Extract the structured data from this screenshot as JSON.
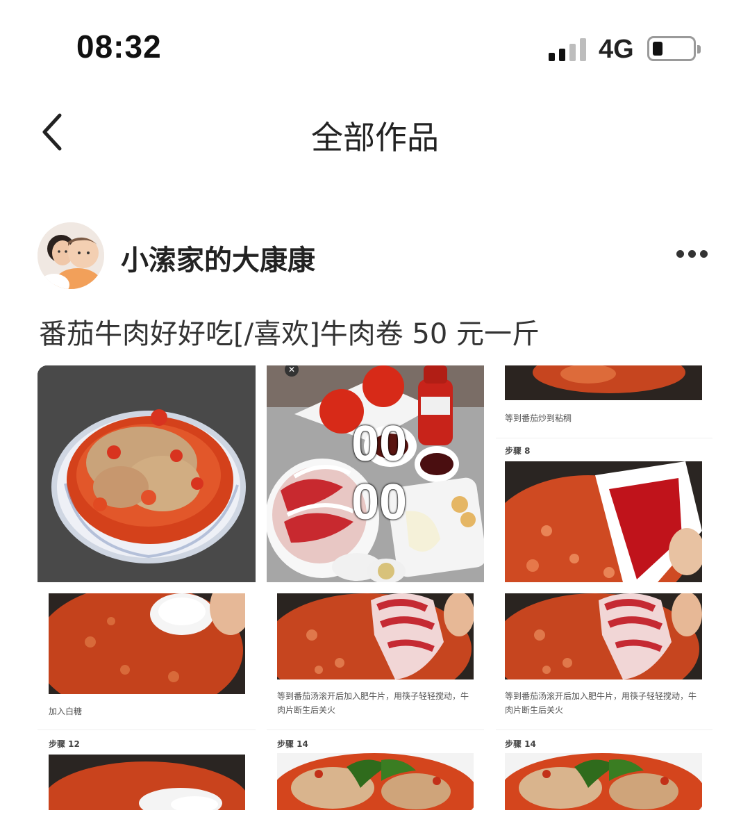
{
  "status_bar": {
    "time": "08:32",
    "network": "4G",
    "signal_bars_active": 2,
    "battery_level": 0.2
  },
  "nav": {
    "title": "全部作品",
    "back_icon": "chevron-left-icon"
  },
  "author": {
    "name": "小溹家的大康康",
    "more_icon": "more-horizontal-icon"
  },
  "post": {
    "text": "番茄牛肉好好吃[/喜欢]牛肉卷 50 元一斤"
  },
  "grid": {
    "overlay_timer_top": "00",
    "overlay_timer_bottom": "00",
    "col3_top_caption": "等到番茄炒到粘稠",
    "col3_step_label": "步骤 8",
    "row2_col1_caption": "加入白糖",
    "row2_col2_caption": "等到番茄汤滚开后加入肥牛片，用筷子轻轻搅动，牛肉片断生后关火",
    "row2_col3_caption": "等到番茄汤滚开后加入肥牛片，用筷子轻轻搅动，牛肉片断生后关火",
    "row3_col1_step": "步骤 12",
    "row3_col2_step": "步骤 14",
    "row3_col3_step": "步骤 14"
  },
  "colors": {
    "soup": "#c8441c",
    "tomato": "#d8331f",
    "beef": "#c9a37a",
    "pan": "#2a2522"
  }
}
